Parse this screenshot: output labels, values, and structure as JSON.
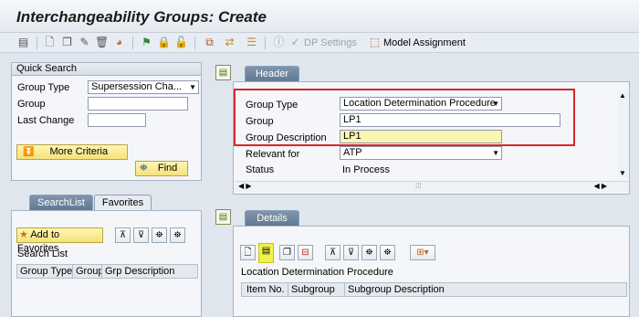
{
  "window": {
    "title": "Interchangeability Groups: Create"
  },
  "toolbar": {
    "dp_settings_label": "DP Settings",
    "model_assignment_label": "Model Assignment"
  },
  "quick_search": {
    "title": "Quick Search",
    "group_type_label": "Group Type",
    "group_type_value": "Supersession Cha...",
    "group_label": "Group",
    "group_value": "",
    "last_change_label": "Last Change",
    "last_change_value": "",
    "more_criteria_label": "More Criteria",
    "find_label": "Find"
  },
  "search_tabs": {
    "searchlist": "SearchList",
    "favorites": "Favorites"
  },
  "search_list": {
    "add_to_favorites_label": "Add to Favorites",
    "title": "Search List",
    "columns": [
      "Group Type",
      "Group",
      "Grp Description"
    ]
  },
  "header_tab": {
    "label": "Header"
  },
  "header_form": {
    "group_type_label": "Group Type",
    "group_type_value": "Location Determination Procedure",
    "group_label": "Group",
    "group_value": "LP1",
    "group_description_label": "Group Description",
    "group_description_value": "LP1",
    "relevant_for_label": "Relevant for",
    "relevant_for_value": "ATP",
    "status_label": "Status",
    "status_value": "In Process"
  },
  "details_tab": {
    "label": "Details"
  },
  "details": {
    "section_title": "Location Determination Procedure",
    "columns": [
      "Item No.",
      "Subgroup",
      "Subgroup Description"
    ]
  },
  "colors": {
    "highlight_red": "#d9262b",
    "active_tab": "#5f7790"
  }
}
